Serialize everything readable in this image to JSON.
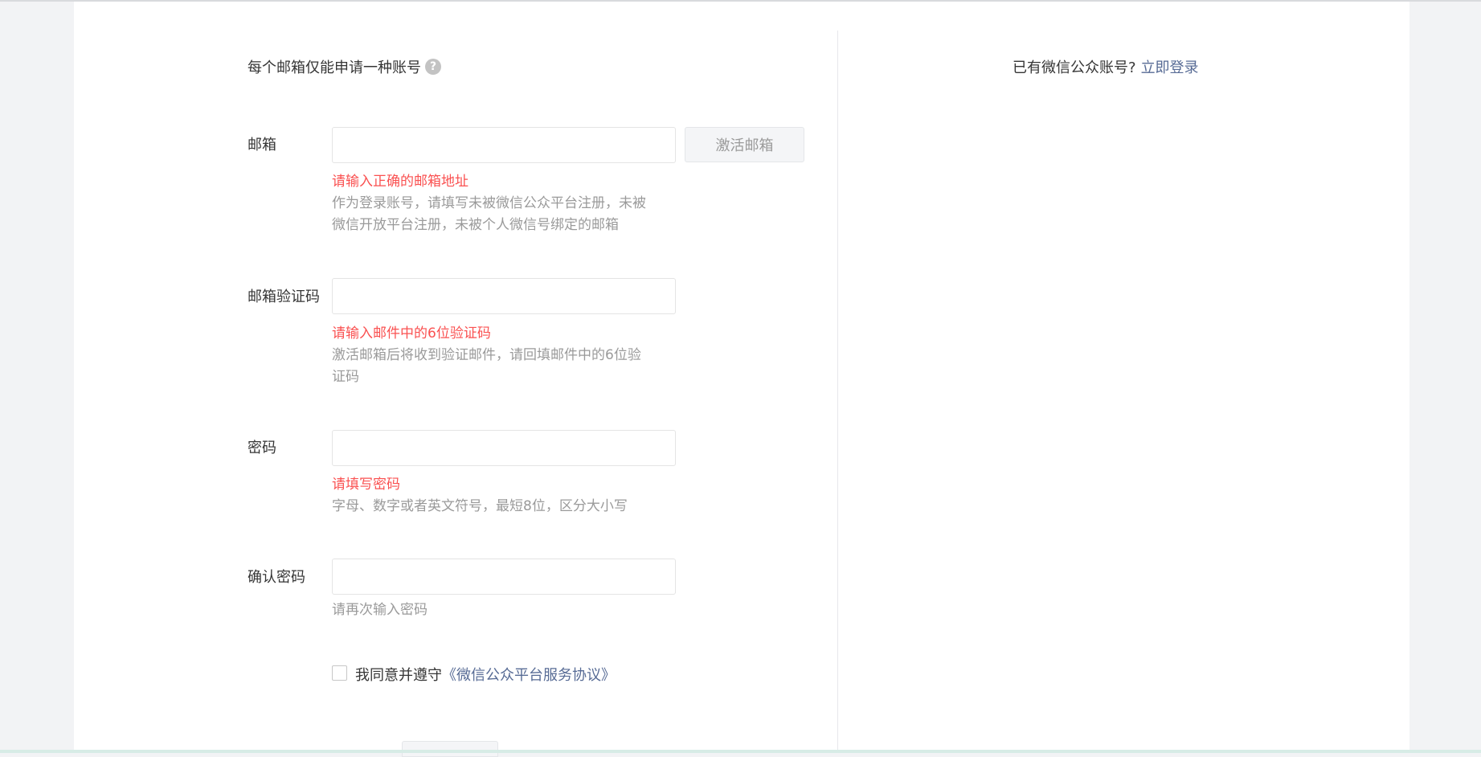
{
  "form": {
    "notice": "每个邮箱仅能申请一种账号",
    "help_glyph": "?",
    "email": {
      "label": "邮箱",
      "value": "",
      "activate_button": "激活邮箱",
      "error": "请输入正确的邮箱地址",
      "tip": "作为登录账号，请填写未被微信公众平台注册，未被微信开放平台注册，未被个人微信号绑定的邮箱"
    },
    "code": {
      "label": "邮箱验证码",
      "value": "",
      "error": "请输入邮件中的6位验证码",
      "tip": "激活邮箱后将收到验证邮件，请回填邮件中的6位验证码"
    },
    "password": {
      "label": "密码",
      "value": "",
      "error": "请填写密码",
      "tip": "字母、数字或者英文符号，最短8位，区分大小写"
    },
    "confirm": {
      "label": "确认密码",
      "value": "",
      "tip": "请再次输入密码"
    },
    "agreement": {
      "prefix": "我同意并遵守",
      "link": "《微信公众平台服务协议》",
      "checked": false
    }
  },
  "side": {
    "question": "已有微信公众账号?",
    "login_link": "立即登录"
  },
  "colors": {
    "error": "#fa5151",
    "link": "#576b95",
    "tip": "#9a9a9a"
  }
}
